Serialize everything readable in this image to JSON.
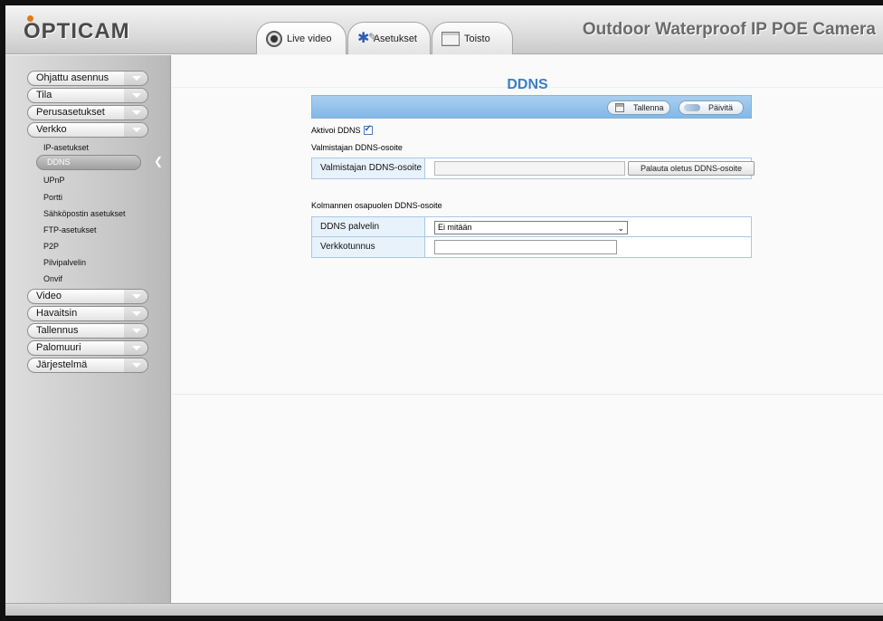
{
  "header": {
    "logo": "OPTICAM",
    "title": "Outdoor Waterproof IP POE Camera",
    "tabs": [
      {
        "label": "Live video",
        "icon": "camera-icon"
      },
      {
        "label": "Asetukset",
        "icon": "gear-icon"
      },
      {
        "label": "Toisto",
        "icon": "film-icon"
      }
    ]
  },
  "sidebar": {
    "menus": [
      {
        "label": "Ohjattu asennus"
      },
      {
        "label": "Tila"
      },
      {
        "label": "Perusasetukset"
      },
      {
        "label": "Verkko"
      },
      {
        "label": "Video"
      },
      {
        "label": "Havaitsin"
      },
      {
        "label": "Tallennus"
      },
      {
        "label": "Palomuuri"
      },
      {
        "label": "Järjestelmä"
      }
    ],
    "verkko_sub": [
      {
        "label": "IP-asetukset"
      },
      {
        "label": "DDNS"
      },
      {
        "label": "UPnP"
      },
      {
        "label": "Portti"
      },
      {
        "label": "Sähköpostin asetukset"
      },
      {
        "label": "FTP-asetukset"
      },
      {
        "label": "P2P"
      },
      {
        "label": "Pilvipalvelin"
      },
      {
        "label": "Onvif"
      }
    ],
    "selected": "DDNS"
  },
  "main": {
    "title": "DDNS",
    "toolbar": {
      "save_label": "Tallenna",
      "refresh_label": "Päivitä"
    },
    "enable_label": "Aktivoi DDNS",
    "enable_checked": true,
    "manufacturer_section": "Valmistajan DDNS-osoite",
    "manufacturer_field_label": "Valmistajan DDNS-osoite",
    "manufacturer_value": "",
    "restore_button": "Palauta oletus DDNS-osoite",
    "third_party_section": "Kolmannen osapuolen DDNS-osoite",
    "ddns_server_label": "DDNS palvelin",
    "ddns_server_value": "Ei mitään",
    "domain_label": "Verkkotunnus",
    "domain_value": ""
  },
  "colors": {
    "accent": "#3c7fc2",
    "toolbar": "#a9cff0",
    "table_border": "#a8c8e8"
  }
}
